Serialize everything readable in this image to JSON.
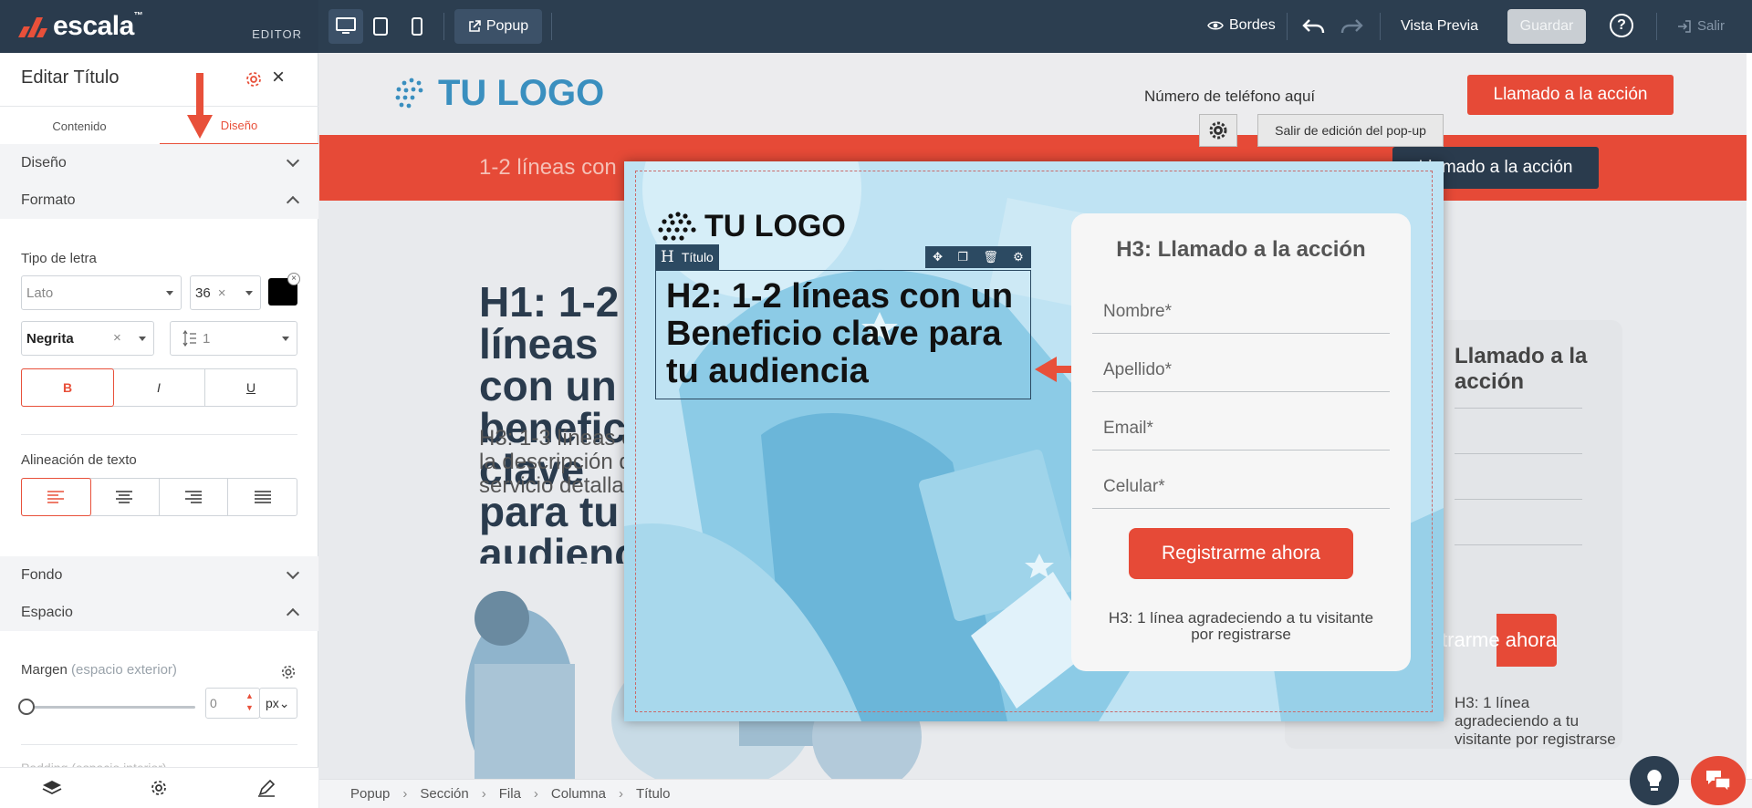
{
  "brand": {
    "name": "escala",
    "tm": "™",
    "section": "EDITOR"
  },
  "topbar": {
    "popup_label": "Popup",
    "borders_label": "Bordes",
    "preview_label": "Vista Previa",
    "save_label": "Guardar",
    "help_label": "?",
    "exit_label": "Salir"
  },
  "panel": {
    "title": "Editar Título",
    "tabs": [
      "Contenido",
      "Diseño"
    ],
    "sections": {
      "diseno": "Diseño",
      "formato": "Formato",
      "fondo": "Fondo",
      "espacio": "Espacio"
    },
    "font_label": "Tipo de letra",
    "font_value": "Lato",
    "size_value": "36",
    "weight_value": "Negrita",
    "line_height_value": "1",
    "text_color": "#000000",
    "style_buttons": [
      "B",
      "I",
      "U"
    ],
    "align_label": "Alineación de texto",
    "margin_label": "Margen",
    "margin_sub": "(espacio exterior)",
    "margin_value": "0",
    "margin_unit": "px",
    "cutoff_label": "Padding (espacio interior)"
  },
  "page": {
    "logo": "TU LOGO",
    "phone": "Número de teléfono aquí",
    "cta_top": "Llamado a la acción",
    "banner_text": "1-2 líneas con",
    "banner_cta": "Llamado a la acción",
    "h1": "H1: 1-2 líneas con un beneficio clave para tu audiencia",
    "h3": "H3: 1-3 líneas con la descripción del servicio detallado",
    "form_title": "Llamado a la acción",
    "form_btn": "Registrarme ahora",
    "form_note": "H3: 1 línea agradeciendo a tu visitante por registrarse"
  },
  "popup_controls": {
    "exit_edit": "Salir de edición del pop-up"
  },
  "popup": {
    "logo": "TU LOGO",
    "element_tag": "Título",
    "element_tag_glyph": "H",
    "h2": "H2: 1-2 líneas con un Beneficio clave para tu audiencia",
    "form_title": "H3: Llamado a la acción",
    "fields": [
      "Nombre*",
      "Apellido*",
      "Email*",
      "Celular*"
    ],
    "submit": "Registrarme ahora",
    "note": "H3: 1 línea agradeciendo a tu visitante por registrarse"
  },
  "breadcrumb": [
    "Popup",
    "Sección",
    "Fila",
    "Columna",
    "Título"
  ],
  "colors": {
    "accent": "#e8503a",
    "topbar": "#2c3e50",
    "popup_bg": "#bfe3f3"
  }
}
